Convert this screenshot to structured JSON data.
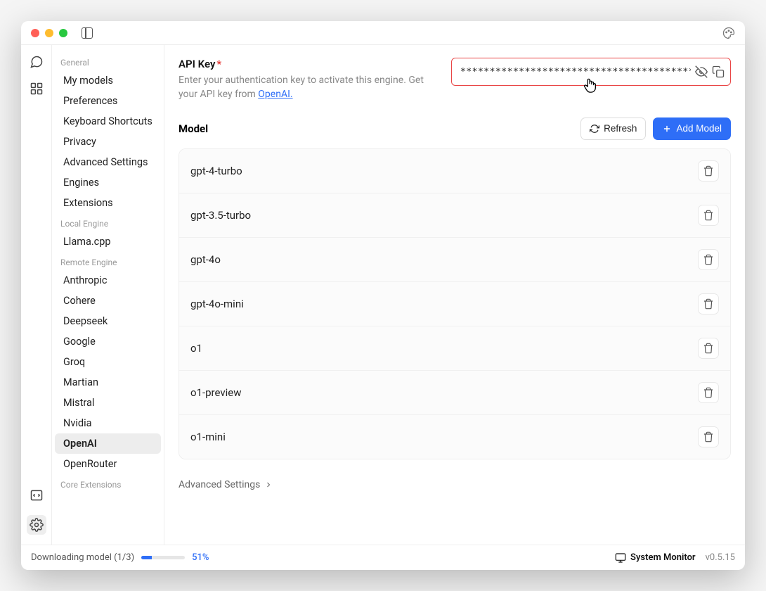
{
  "sidebar": {
    "groups": [
      {
        "label": "General",
        "items": [
          "My models",
          "Preferences",
          "Keyboard Shortcuts",
          "Privacy",
          "Advanced Settings",
          "Engines",
          "Extensions"
        ]
      },
      {
        "label": "Local Engine",
        "items": [
          "Llama.cpp"
        ]
      },
      {
        "label": "Remote Engine",
        "items": [
          "Anthropic",
          "Cohere",
          "Deepseek",
          "Google",
          "Groq",
          "Martian",
          "Mistral",
          "Nvidia",
          "OpenAI",
          "OpenRouter"
        ]
      },
      {
        "label": "Core Extensions",
        "items": []
      }
    ],
    "active": "OpenAI"
  },
  "apikey": {
    "label": "API Key",
    "required": "*",
    "desc_pre": "Enter your authentication key to activate this engine. Get your API key from ",
    "desc_link": "OpenAI.",
    "value": "**********************************************"
  },
  "model_section": {
    "title": "Model",
    "refresh_label": "Refresh",
    "add_label": "Add Model"
  },
  "models": [
    "gpt-4-turbo",
    "gpt-3.5-turbo",
    "gpt-4o",
    "gpt-4o-mini",
    "o1",
    "o1-preview",
    "o1-mini"
  ],
  "adv_settings_label": "Advanced Settings",
  "status": {
    "download_label": "Downloading model (1/3)",
    "percent": "51%",
    "progress_width": "24%",
    "monitor": "System Monitor",
    "version": "v0.5.15"
  }
}
